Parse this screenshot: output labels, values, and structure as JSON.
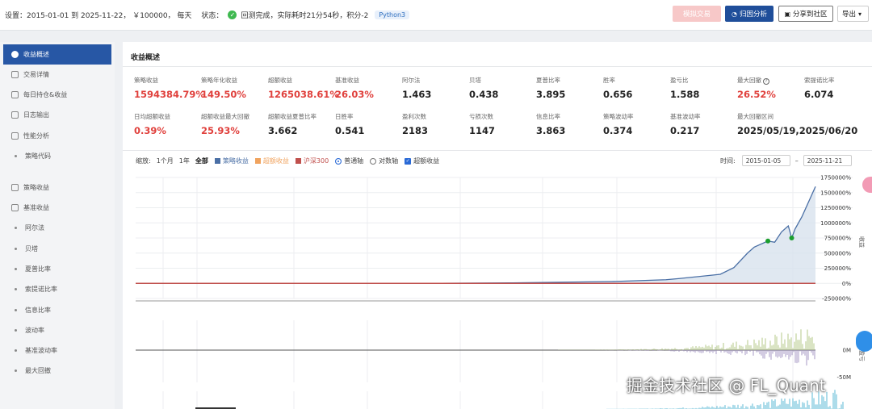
{
  "topbar": {
    "settings_text": "设置：2015-01-01 到 2025-11-22， ￥100000， 每天",
    "status_label": "状态：",
    "status_text": "回测完成，实际耗时21分54秒，积分-2",
    "python_badge": "Python3",
    "buttons": {
      "simulate": "模拟交易",
      "attribution": "归因分析",
      "share": "分享到社区",
      "export": "导出"
    }
  },
  "sidebar": {
    "items": [
      {
        "label": "收益概述",
        "active": true
      },
      {
        "label": "交易详情"
      },
      {
        "label": "每日持仓&收益"
      },
      {
        "label": "日志输出"
      },
      {
        "label": "性能分析"
      },
      {
        "label": "策略代码",
        "sub": true
      },
      {
        "label": "策略收益"
      },
      {
        "label": "基准收益"
      },
      {
        "label": "阿尔法",
        "sub": true
      },
      {
        "label": "贝塔",
        "sub": true
      },
      {
        "label": "夏普比率",
        "sub": true
      },
      {
        "label": "索提诺比率",
        "sub": true
      },
      {
        "label": "信息比率",
        "sub": true
      },
      {
        "label": "波动率",
        "sub": true
      },
      {
        "label": "基准波动率",
        "sub": true
      },
      {
        "label": "最大回撤",
        "sub": true
      }
    ]
  },
  "panel": {
    "title": "收益概述",
    "metrics_row1": [
      {
        "label": "策略收益",
        "value": "1594384.79%",
        "color": "red"
      },
      {
        "label": "策略年化收益",
        "value": "149.50%",
        "color": "red"
      },
      {
        "label": "超额收益",
        "value": "1265038.61%",
        "color": "red"
      },
      {
        "label": "基准收益",
        "value": "26.03%",
        "color": "red"
      },
      {
        "label": "阿尔法",
        "value": "1.463"
      },
      {
        "label": "贝塔",
        "value": "0.438"
      },
      {
        "label": "夏普比率",
        "value": "3.895"
      },
      {
        "label": "胜率",
        "value": "0.656"
      },
      {
        "label": "盈亏比",
        "value": "1.588"
      },
      {
        "label": "最大回撤",
        "value": "26.52%",
        "color": "red",
        "help": true
      },
      {
        "label": "索提诺比率",
        "value": "6.074"
      }
    ],
    "metrics_row2": [
      {
        "label": "日均超额收益",
        "value": "0.39%",
        "color": "red"
      },
      {
        "label": "超额收益最大回撤",
        "value": "25.93%",
        "color": "red"
      },
      {
        "label": "超额收益夏普比率",
        "value": "3.662"
      },
      {
        "label": "日胜率",
        "value": "0.541"
      },
      {
        "label": "盈利次数",
        "value": "2183"
      },
      {
        "label": "亏损次数",
        "value": "1147"
      },
      {
        "label": "信息比率",
        "value": "3.863"
      },
      {
        "label": "策略波动率",
        "value": "0.374"
      },
      {
        "label": "基准波动率",
        "value": "0.217"
      },
      {
        "label": "最大回撤区间",
        "value": "2025/05/19,2025/06/20",
        "wide": true
      }
    ]
  },
  "chart_controls": {
    "zoom_label": "缩放:",
    "zoom_options": [
      "1个月",
      "1年",
      "全部"
    ],
    "zoom_selected": "全部",
    "legend": [
      {
        "label": "策略收益",
        "color": "#4a6fa5"
      },
      {
        "label": "超额收益",
        "color": "#f0a35e"
      },
      {
        "label": "沪深300",
        "color": "#c0504d"
      }
    ],
    "axis_options": [
      {
        "label": "普通轴",
        "checked": true
      },
      {
        "label": "对数轴",
        "checked": false
      }
    ],
    "excess_checkbox": "超额收益",
    "time_label": "时间:",
    "date_from": "2015-01-05",
    "date_to": "2025-11-21",
    "date_sep": "–"
  },
  "chart_data": [
    {
      "type": "area",
      "ylabel": "收益",
      "y_tick_labels": [
        "1750000%",
        "1500000%",
        "1250000%",
        "1000000%",
        "750000%",
        "500000%",
        "250000%",
        "0%",
        "-250000%"
      ],
      "ylim": [
        -250000,
        1750000
      ],
      "x": [
        0,
        0.3,
        0.45,
        0.55,
        0.6,
        0.7,
        0.78,
        0.8,
        0.86,
        0.88,
        0.9,
        0.91,
        0.93,
        0.94,
        0.95,
        0.96,
        0.965,
        0.97,
        0.98,
        0.99,
        1.0
      ],
      "series": [
        {
          "name": "策略收益",
          "values": [
            0,
            500,
            2000,
            8000,
            15000,
            30000,
            60000,
            80000,
            150000,
            260000,
            500000,
            600000,
            700000,
            680000,
            850000,
            950000,
            750000,
            900000,
            1100000,
            1350000,
            1600000
          ]
        },
        {
          "name": "沪深300",
          "values": [
            0,
            0,
            0,
            0,
            0,
            0,
            0,
            0,
            0,
            0,
            0,
            0,
            0,
            0,
            0,
            0,
            0,
            0,
            0,
            0,
            26
          ]
        }
      ]
    },
    {
      "type": "bar",
      "ylabel": "每日盈亏",
      "y_tick_labels": [
        "0M",
        "-50M"
      ],
      "ylim": [
        -60,
        60
      ]
    },
    {
      "type": "bar",
      "y_tick_labels": []
    }
  ],
  "watermark": "掘金技术社区 @ FL_Quant"
}
